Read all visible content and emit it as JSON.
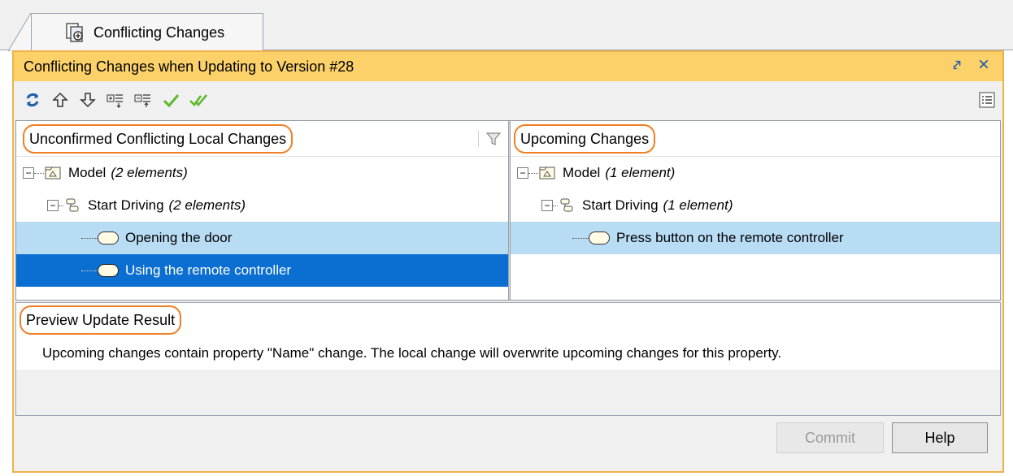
{
  "tab": {
    "label": "Conflicting Changes",
    "icon": "conflict-icon"
  },
  "window": {
    "title": "Conflicting Changes when Updating to Version #28"
  },
  "toolbar": {
    "icons": [
      "refresh-icon",
      "up-arrow-icon",
      "down-arrow-icon",
      "expand-all-icon",
      "collapse-all-icon",
      "confirm-icon",
      "confirm-all-icon"
    ],
    "right_icon": "options-icon"
  },
  "left_pane": {
    "header": "Unconfirmed Conflicting Local Changes",
    "tree": [
      {
        "label": "Model",
        "count": "(2 elements)",
        "icon": "model-icon"
      },
      {
        "label": "Start Driving",
        "count": "(2 elements)",
        "icon": "activity-icon"
      },
      {
        "label": "Opening the door",
        "icon": "action-icon",
        "selected": "light"
      },
      {
        "label": "Using the remote controller",
        "icon": "action-icon",
        "selected": "dark"
      }
    ]
  },
  "right_pane": {
    "header": "Upcoming Changes",
    "tree": [
      {
        "label": "Model",
        "count": "(1 element)",
        "icon": "model-icon"
      },
      {
        "label": "Start Driving",
        "count": "(1 element)",
        "icon": "activity-icon"
      },
      {
        "label": "Press button on the remote controller",
        "icon": "action-icon",
        "selected": "light"
      }
    ]
  },
  "preview": {
    "header": "Preview Update Result",
    "text": "Upcoming changes contain property \"Name\"  change. The local change will overwrite upcoming changes for this property."
  },
  "buttons": {
    "commit": "Commit",
    "help": "Help"
  },
  "colors": {
    "title_bar": "#fcd16a",
    "highlight_ring": "#f07f24",
    "selection_light": "#b9dcf5",
    "selection_dark": "#0a6fd0"
  }
}
